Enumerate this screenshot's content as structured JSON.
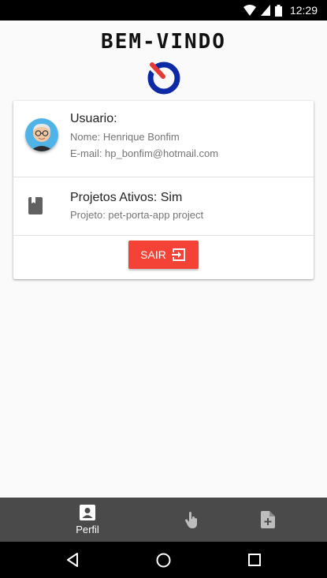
{
  "status": {
    "time": "12:29"
  },
  "header": {
    "title": "BEM-VINDO"
  },
  "user": {
    "heading": "Usuario:",
    "name": "Nome: Henrique Bonfim",
    "email": "E-mail: hp_bonfim@hotmail.com"
  },
  "project": {
    "heading": "Projetos Ativos: Sim",
    "detail": "Projeto: pet-porta-app project"
  },
  "actions": {
    "logout_label": "SAIR"
  },
  "bottom_nav": {
    "items": [
      {
        "label": "Perfil",
        "icon": "account-box-icon"
      },
      {
        "label": "",
        "icon": "touch-icon"
      },
      {
        "label": "",
        "icon": "note-add-icon"
      }
    ]
  },
  "colors": {
    "accent": "#f44336",
    "nav_bg": "#4a4a4a",
    "logo_blue": "#0d2aa6",
    "logo_red": "#e53935"
  }
}
